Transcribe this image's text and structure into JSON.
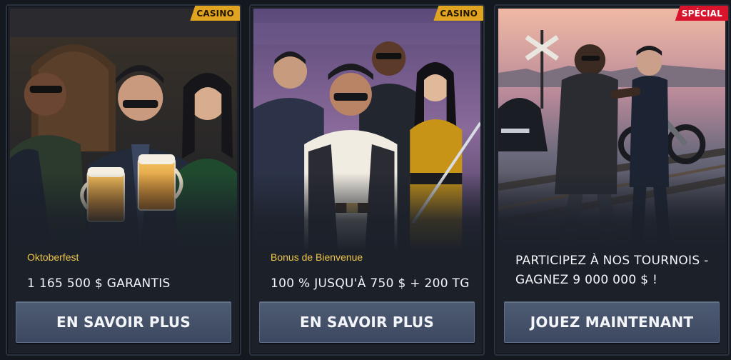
{
  "promotions": [
    {
      "badge": "CASINO",
      "subtitle": "Oktoberfest",
      "headline": "1 165 500 $ GARANTIS",
      "button_label": "EN SAVOIR PLUS",
      "artwork": "characters-toasting-beer"
    },
    {
      "badge": "CASINO",
      "subtitle": "Bonus de Bienvenue",
      "headline": "100 % JUSQU'À 750 $ + 200 TG",
      "button_label": "EN SAVOIR PLUS",
      "artwork": "gang-group-portrait"
    },
    {
      "badge": "SPÉCIAL",
      "subtitle": "",
      "headline": "PARTICIPEZ À NOS TOURNOIS - GAGNEZ 9 000 000 $ !",
      "button_label": "JOUEZ MAINTENANT",
      "artwork": "handshake-at-railroad-crossing"
    }
  ],
  "colors": {
    "casino_badge": "#e0a421",
    "special_badge": "#d8142c",
    "subtitle": "#efc44a",
    "button": "#46536b",
    "card_bg": "#1b2029"
  }
}
